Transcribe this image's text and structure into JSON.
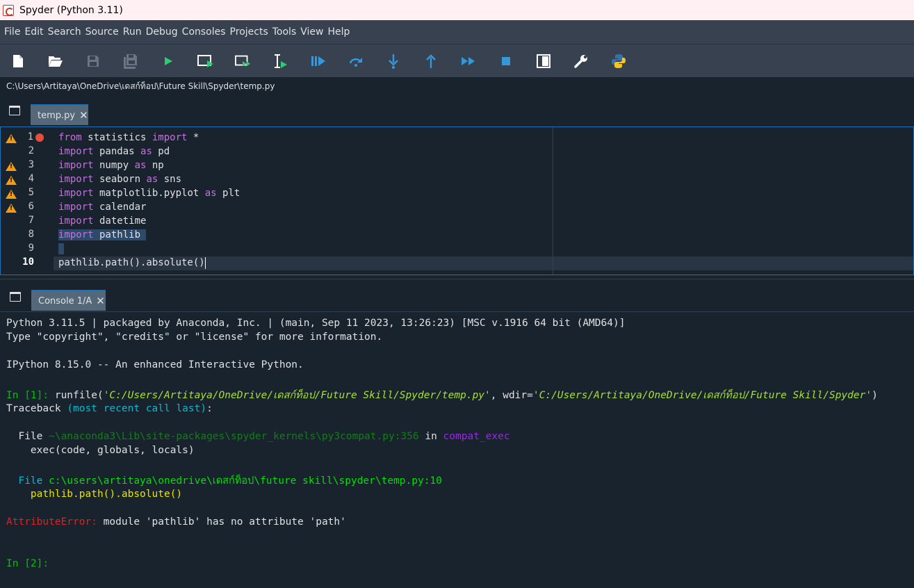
{
  "window": {
    "title": "Spyder (Python 3.11)"
  },
  "menu": [
    "File",
    "Edit",
    "Search",
    "Source",
    "Run",
    "Debug",
    "Consoles",
    "Projects",
    "Tools",
    "View",
    "Help"
  ],
  "toolbar": {
    "icons": [
      "new-file-icon",
      "open-file-icon",
      "save-icon",
      "save-all-icon",
      "run-icon",
      "run-cell-icon",
      "run-cell-advance-icon",
      "run-selection-icon",
      "debug-icon",
      "step-over-icon",
      "step-into-icon",
      "step-return-icon",
      "continue-icon",
      "stop-icon",
      "maximize-pane-icon",
      "preferences-icon",
      "python-path-icon"
    ],
    "accent": "#1a72bb"
  },
  "path": "C:\\Users\\Artitaya\\OneDrive\\เดสก์ท็อป\\Future Skill\\Spyder\\temp.py",
  "editor": {
    "tab_label": "temp.py",
    "current_line": "10",
    "lines": [
      {
        "n": "1",
        "kw": "from",
        "rest": " statistics ",
        "kw2": "import",
        "rest2": " *",
        "warn": true,
        "bp": true
      },
      {
        "n": "2",
        "kw": "import",
        "rest": " pandas ",
        "kw2": "as",
        "rest2": " pd",
        "warn": false,
        "bp": false
      },
      {
        "n": "3",
        "kw": "import",
        "rest": " numpy ",
        "kw2": "as",
        "rest2": " np",
        "warn": true,
        "bp": false
      },
      {
        "n": "4",
        "kw": "import",
        "rest": " seaborn ",
        "kw2": "as",
        "rest2": " sns",
        "warn": true,
        "bp": false
      },
      {
        "n": "5",
        "kw": "import",
        "rest": " matplotlib.pyplot ",
        "kw2": "as",
        "rest2": " plt",
        "warn": true,
        "bp": false
      },
      {
        "n": "6",
        "kw": "import",
        "rest": " calendar",
        "kw2": "",
        "rest2": "",
        "warn": true,
        "bp": false
      },
      {
        "n": "7",
        "kw": "import",
        "rest": " datetime",
        "kw2": "",
        "rest2": "",
        "warn": false,
        "bp": false
      },
      {
        "n": "8",
        "kw": "import",
        "rest": " pathlib",
        "kw2": "",
        "rest2": "",
        "warn": false,
        "bp": false
      },
      {
        "n": "9",
        "kw": "",
        "rest": "",
        "kw2": "",
        "rest2": "",
        "warn": false,
        "bp": false
      },
      {
        "n": "10",
        "kw": "",
        "rest": "pathlib.path().absolute()",
        "kw2": "",
        "rest2": "",
        "warn": false,
        "bp": false
      }
    ]
  },
  "console": {
    "tab_label": "Console 1/A",
    "banner1": "Python 3.11.5 | packaged by Anaconda, Inc. | (main, Sep 11 2023, 13:26:23) [MSC v.1916 64 bit (AMD64)]",
    "banner2": "Type \"copyright\", \"credits\" or \"license\" for more information.",
    "banner3": "IPython 8.15.0 -- An enhanced Interactive Python.",
    "in1_prompt": "In [1]:",
    "in1_cmd": " runfile(",
    "in1_arg1": "'C:/Users/Artitaya/OneDrive/เดสก์ท็อป/Future Skill/Spyder/temp.py'",
    "in1_sep": ", wdir=",
    "in1_arg2": "'C:/Users/Artitaya/OneDrive/เดสก์ท็อป/Future Skill/Spyder'",
    "in1_end": ")",
    "tb_word": "Traceback ",
    "tb_paren": "(most recent call last)",
    "tb_colon": ":",
    "file1_label": "  File ",
    "file1_path": "~\\anaconda3\\Lib\\site-packages\\spyder_kernels\\py3compat.py:356",
    "file1_in": " in ",
    "file1_func": "compat_exec",
    "file1_code": "    exec(code, globals, locals)",
    "file2_label": "  File ",
    "file2_path": "c:\\users\\artitaya\\onedrive\\เดสก์ท็อป\\future skill\\spyder\\temp.py:10",
    "file2_code": "    pathlib.path().absolute()",
    "err_name": "AttributeError:",
    "err_msg": " module 'pathlib' has no attribute 'path'",
    "in2_prompt": "In [2]:"
  }
}
